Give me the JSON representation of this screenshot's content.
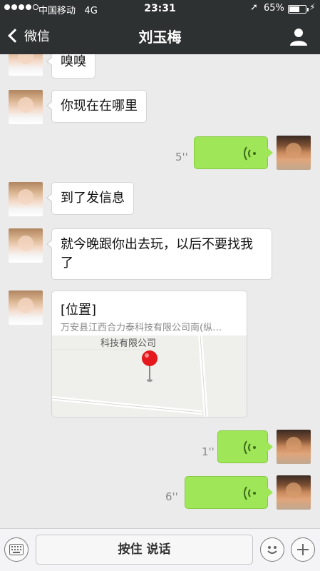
{
  "status_bar": {
    "carrier": "中国移动",
    "network": "4G",
    "time": "23:31",
    "battery_percent": "65%",
    "battery_level": 0.65
  },
  "nav": {
    "back_label": "微信",
    "title": "刘玉梅"
  },
  "messages": [
    {
      "side": "left",
      "type": "text",
      "text": "嗅嗅"
    },
    {
      "side": "left",
      "type": "text",
      "text": "你现在在哪里"
    },
    {
      "side": "right",
      "type": "voice",
      "duration": "5''"
    },
    {
      "side": "left",
      "type": "text",
      "text": "到了发信息"
    },
    {
      "side": "left",
      "type": "text",
      "text": "就今晚跟你出去玩，以后不要找我了"
    },
    {
      "side": "left",
      "type": "location",
      "title": "[位置]",
      "address": "万安县江西合力泰科技有限公司南(纵…",
      "map_label": "科技有限公司"
    },
    {
      "side": "right",
      "type": "voice",
      "duration": "1''"
    },
    {
      "side": "right",
      "type": "voice",
      "duration": "6''"
    }
  ],
  "input_bar": {
    "hold_to_talk": "按住 说话"
  },
  "colors": {
    "bar_bg": "#2e3132",
    "chat_bg": "#ebebeb",
    "voice_bubble": "#9fe658"
  }
}
